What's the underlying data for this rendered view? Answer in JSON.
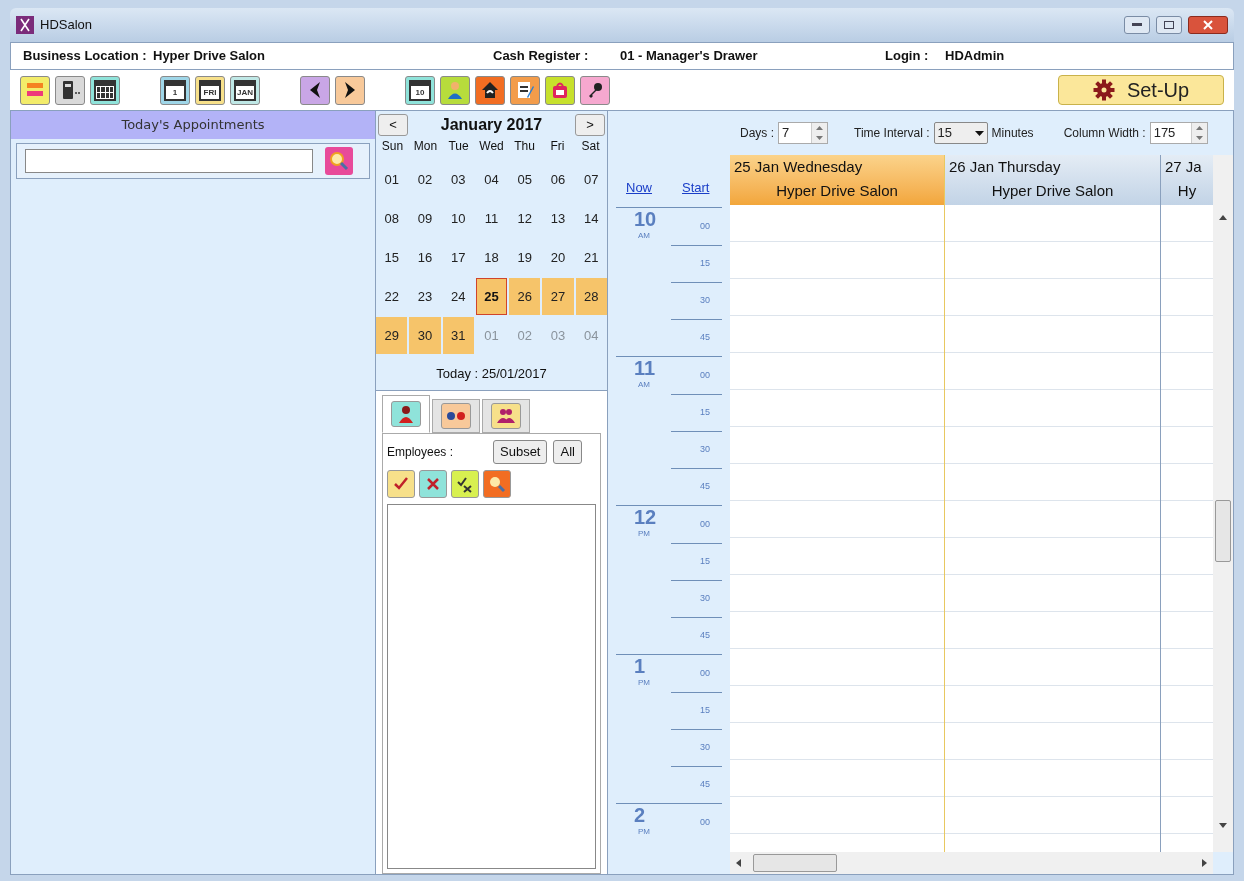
{
  "window": {
    "title": "HDSalon"
  },
  "info_bar": {
    "business_label": "Business Location :",
    "business_value": "Hyper Drive Salon",
    "register_label": "Cash Register :",
    "register_value": "01 - Manager's Drawer",
    "login_label": "Login :",
    "login_value": "HDAdmin"
  },
  "toolbar": [
    {
      "kind": "bars"
    },
    {
      "kind": "device"
    },
    {
      "kind": "calendar"
    },
    {
      "kind": "gap"
    },
    {
      "kind": "cal-day",
      "label": "1"
    },
    {
      "kind": "cal-week",
      "label": "FRI"
    },
    {
      "kind": "cal-month",
      "label": "JAN"
    },
    {
      "kind": "gap"
    },
    {
      "kind": "prev"
    },
    {
      "kind": "next"
    },
    {
      "kind": "gap"
    },
    {
      "kind": "cal-ten",
      "label": "10"
    },
    {
      "kind": "person"
    },
    {
      "kind": "house"
    },
    {
      "kind": "note"
    },
    {
      "kind": "bag"
    },
    {
      "kind": "key"
    }
  ],
  "setup_button": {
    "label": "Set-Up"
  },
  "appointments": {
    "title": "Today's Appointments"
  },
  "calendar": {
    "month": "January 2017",
    "prev": "<",
    "next": ">",
    "weekdays": [
      "Sun",
      "Mon",
      "Tue",
      "Wed",
      "Thu",
      "Fri",
      "Sat"
    ],
    "weeks": [
      [
        {
          "label": "01",
          "kind": "normal"
        },
        {
          "label": "02",
          "kind": "normal"
        },
        {
          "label": "03",
          "kind": "normal"
        },
        {
          "label": "04",
          "kind": "normal"
        },
        {
          "label": "05",
          "kind": "normal"
        },
        {
          "label": "06",
          "kind": "normal"
        },
        {
          "label": "07",
          "kind": "normal"
        }
      ],
      [
        {
          "label": "08",
          "kind": "normal"
        },
        {
          "label": "09",
          "kind": "normal"
        },
        {
          "label": "10",
          "kind": "normal"
        },
        {
          "label": "11",
          "kind": "normal"
        },
        {
          "label": "12",
          "kind": "normal"
        },
        {
          "label": "13",
          "kind": "normal"
        },
        {
          "label": "14",
          "kind": "normal"
        }
      ],
      [
        {
          "label": "15",
          "kind": "normal"
        },
        {
          "label": "16",
          "kind": "normal"
        },
        {
          "label": "17",
          "kind": "normal"
        },
        {
          "label": "18",
          "kind": "normal"
        },
        {
          "label": "19",
          "kind": "normal"
        },
        {
          "label": "20",
          "kind": "normal"
        },
        {
          "label": "21",
          "kind": "normal"
        }
      ],
      [
        {
          "label": "22",
          "kind": "normal"
        },
        {
          "label": "23",
          "kind": "normal"
        },
        {
          "label": "24",
          "kind": "normal"
        },
        {
          "label": "25",
          "kind": "today"
        },
        {
          "label": "26",
          "kind": "range"
        },
        {
          "label": "27",
          "kind": "range"
        },
        {
          "label": "28",
          "kind": "range"
        }
      ],
      [
        {
          "label": "29",
          "kind": "range"
        },
        {
          "label": "30",
          "kind": "range"
        },
        {
          "label": "31",
          "kind": "range"
        },
        {
          "label": "01",
          "kind": "other"
        },
        {
          "label": "02",
          "kind": "other"
        },
        {
          "label": "03",
          "kind": "other"
        },
        {
          "label": "04",
          "kind": "other"
        }
      ]
    ],
    "today": "Today : 25/01/2017"
  },
  "lower_tabs": [
    {
      "kind": "person",
      "selected": true
    },
    {
      "kind": "dots",
      "selected": false
    },
    {
      "kind": "group",
      "selected": false
    }
  ],
  "employees": {
    "label": "Employees :",
    "buttons": [
      "Subset",
      "All"
    ],
    "actions": [
      {
        "kind": "check"
      },
      {
        "kind": "cross"
      },
      {
        "kind": "swap"
      },
      {
        "kind": "search"
      }
    ]
  },
  "schedule": {
    "days_label": "Days :",
    "days_value": "7",
    "interval_label": "Time Interval :",
    "interval_value": "15",
    "minutes_label": "Minutes",
    "width_label": "Column Width :",
    "width_value": "175",
    "now_link": "Now",
    "start_link": "Start",
    "columns": [
      {
        "date": "25 Jan Wednesday",
        "location": "Hyper Drive Salon",
        "selected": true
      },
      {
        "date": "26 Jan  Thursday",
        "location": "Hyper Drive Salon",
        "selected": false
      },
      {
        "date": "27 Ja",
        "location": "Hy",
        "selected": false
      }
    ],
    "hours": [
      {
        "hour": "10",
        "period": "AM",
        "slots": [
          "00",
          "15",
          "30",
          "45"
        ]
      },
      {
        "hour": "11",
        "period": "AM",
        "slots": [
          "00",
          "15",
          "30",
          "45"
        ]
      },
      {
        "hour": "12",
        "period": "PM",
        "slots": [
          "00",
          "15",
          "30",
          "45"
        ]
      },
      {
        "hour": "1",
        "period": "PM",
        "slots": [
          "00",
          "15",
          "30",
          "45"
        ]
      },
      {
        "hour": "2",
        "period": "PM",
        "slots": [
          "00"
        ]
      }
    ]
  }
}
